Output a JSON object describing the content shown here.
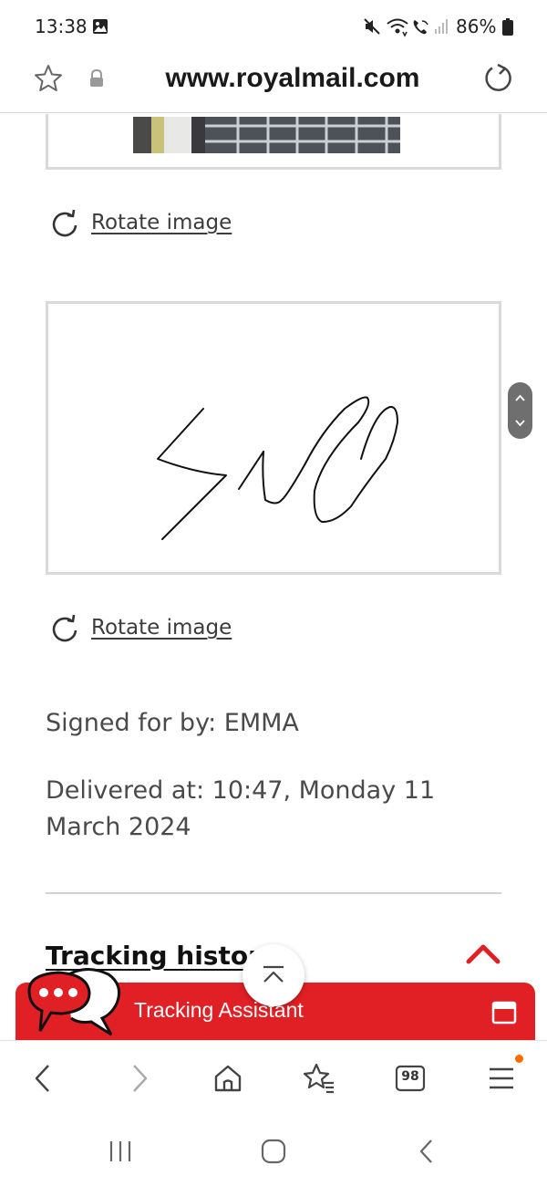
{
  "status_bar": {
    "time": "13:38",
    "battery": "86%",
    "icons": [
      "gallery-icon",
      "mute-icon",
      "wifi-icon",
      "wifi-calling-icon",
      "signal-icon",
      "battery-icon"
    ]
  },
  "browser": {
    "url": "www.royalmail.com",
    "icons": [
      "star-icon",
      "lock-icon",
      "reload-icon"
    ]
  },
  "content": {
    "rotate_label_1": "Rotate image",
    "rotate_label_2": "Rotate image",
    "signed_for": "Signed for by: EMMA",
    "delivered_at": "Delivered at: 10:47, Monday 11 March 2024",
    "tracking_history": "Tracking history",
    "signature_image": "handwritten-signature"
  },
  "assistant": {
    "label": "Tracking Assistant",
    "accent_color": "#e02024",
    "icons": [
      "chat-bubbles-icon",
      "window-icon"
    ]
  },
  "toolbar": {
    "tabs_count": "98",
    "icons": [
      "back-icon",
      "forward-icon",
      "home-icon",
      "bookmarks-icon",
      "tabs-icon",
      "menu-icon"
    ],
    "menu_badge_color": "#ff6a00"
  },
  "nav_bar": {
    "icons": [
      "recents-icon",
      "home-nav-icon",
      "back-nav-icon"
    ]
  }
}
